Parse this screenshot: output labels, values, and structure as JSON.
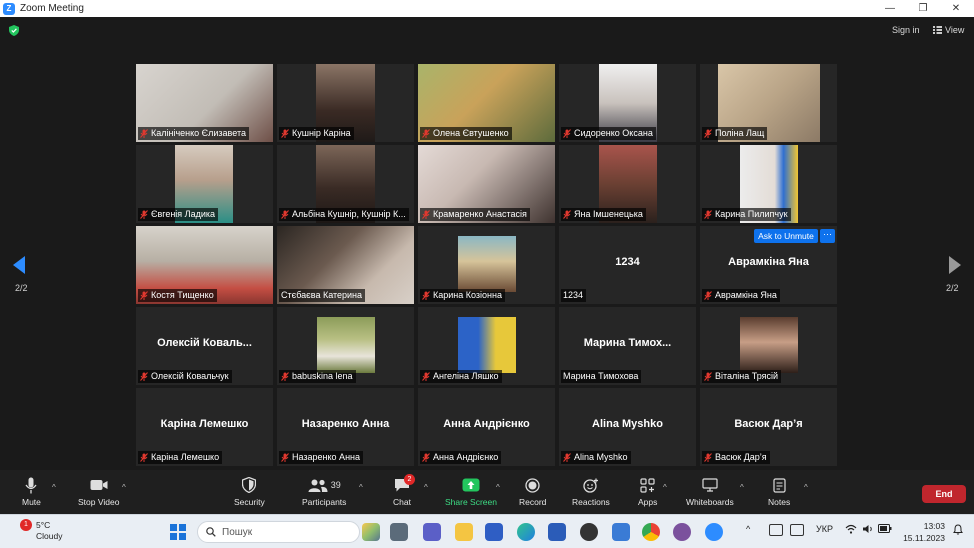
{
  "window": {
    "title": "Zoom Meeting"
  },
  "top": {
    "sign_in": "Sign in",
    "view": "View"
  },
  "pager": {
    "left": "2/2",
    "right": "2/2"
  },
  "ask_unmute": "Ask to Unmute",
  "more": "···",
  "tiles": [
    {
      "label": "Калініченко Єлизавета",
      "muted": true
    },
    {
      "label": "Кушнір Каріна",
      "muted": true
    },
    {
      "label": "Олена Євтушенко",
      "muted": true
    },
    {
      "label": "Сидоренко Оксана",
      "muted": true
    },
    {
      "label": "Поліна Лащ",
      "muted": true
    },
    {
      "label": "Євгенія Ладика",
      "muted": true
    },
    {
      "label": "Альбіна Кушнір, Кушнір К...",
      "muted": true
    },
    {
      "label": "Крамаренко Анастасія",
      "muted": true
    },
    {
      "label": "Яна Імшенецька",
      "muted": true
    },
    {
      "label": "Карина Пилипчук",
      "muted": true
    },
    {
      "label": "Костя Тищенко",
      "muted": true
    },
    {
      "label": "Стєбаєва Катерина",
      "muted": false
    },
    {
      "label": "Карина Козіонна",
      "muted": true
    },
    {
      "label": "1234",
      "big": "1234",
      "muted": false
    },
    {
      "label": "Аврамкіна Яна",
      "big": "Аврамкіна Яна",
      "muted": true
    },
    {
      "label": "Олексій Ковальчук",
      "big": "Олексій Коваль...",
      "muted": true
    },
    {
      "label": "babuskina lena",
      "muted": true
    },
    {
      "label": "Ангеліна Ляшко",
      "muted": true
    },
    {
      "label": "Марина Тимохова",
      "big": "Марина  Тимох...",
      "muted": false
    },
    {
      "label": "Віталіна Трясій",
      "muted": true
    },
    {
      "label": "Каріна Лемешко",
      "big": "Каріна Лемешко",
      "muted": true
    },
    {
      "label": "Назаренко Анна",
      "big": "Назаренко Анна",
      "muted": true
    },
    {
      "label": "Анна Андрієнко",
      "big": "Анна Андрієнко",
      "muted": true
    },
    {
      "label": "Alina Myshko",
      "big": "Alina Myshko",
      "muted": true
    },
    {
      "label": "Васюк Дар’я",
      "big": "Васюк Дар’я",
      "muted": true
    }
  ],
  "toolbar": {
    "mute": "Mute",
    "stop_video": "Stop Video",
    "security": "Security",
    "participants": "Participants",
    "participants_count": "39",
    "chat": "Chat",
    "chat_badge": "2",
    "share_screen": "Share Screen",
    "record": "Record",
    "reactions": "Reactions",
    "apps": "Apps",
    "whiteboards": "Whiteboards",
    "notes": "Notes",
    "end": "End"
  },
  "taskbar": {
    "weather_badge": "1",
    "temperature": "5°C",
    "weather_desc": "Cloudy",
    "search_placeholder": "Пошук",
    "language": "УКР",
    "time": "13:03",
    "date": "15.11.2023"
  },
  "colors": {
    "accent_blue": "#0e72ed",
    "end_red": "#c0262d",
    "share_green": "#23c55e",
    "muted_red": "#e0382f"
  }
}
